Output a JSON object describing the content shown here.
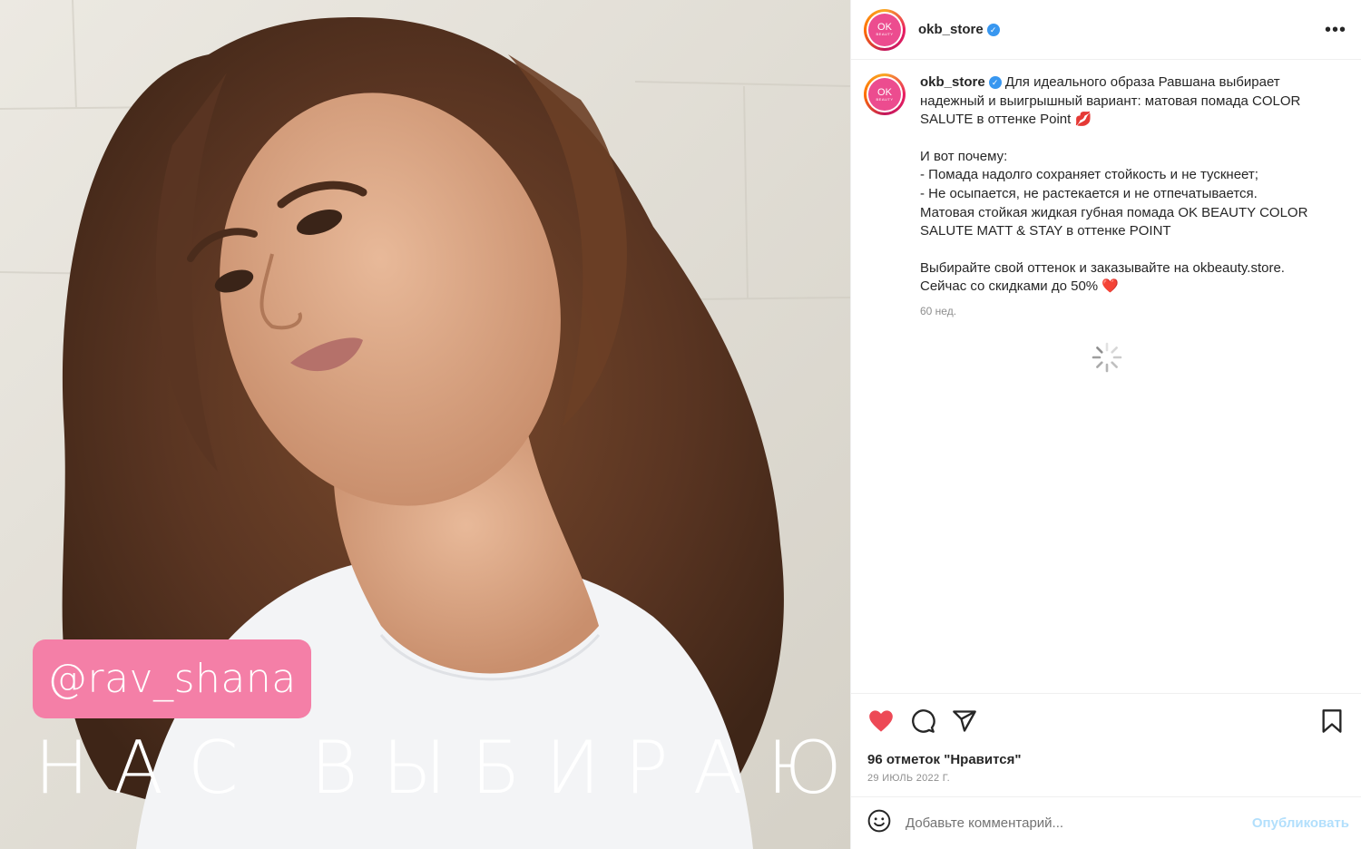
{
  "photo": {
    "tag": "@rav_shana",
    "caption": "НАС ВЫБИРАЮТ",
    "tag_color": "#f47fa7"
  },
  "header": {
    "username": "okb_store",
    "avatar_text": "OK",
    "avatar_subtext": "BEAUTY",
    "more_label": "•••"
  },
  "post": {
    "username": "okb_store",
    "caption_line1": "Для идеального образа Равшана выбирает надежный и выигрышный вариант: матовая помада COLOR SALUTE в оттенке Point 💋",
    "caption_line2": "И вот почему:\n- Помада надолго сохраняет стойкость и не тускнеет;\n- Не осыпается, не растекается и не отпечатывается.\nМатовая стойкая жидкая губная помада OK BEAUTY COLOR SALUTE MATT & STAY в оттенке POINT",
    "caption_line3": "Выбирайте свой оттенок и заказывайте на okbeauty.store.\nСейчас со скидками до 50% ❤️",
    "time_ago": "60 нед."
  },
  "actions": {
    "likes": "96 отметок \"Нравится\"",
    "date": "29 ИЮЛЬ 2022 Г.",
    "like_color": "#ed4956"
  },
  "comment": {
    "placeholder": "Добавьте комментарий...",
    "publish_label": "Опубликовать"
  }
}
